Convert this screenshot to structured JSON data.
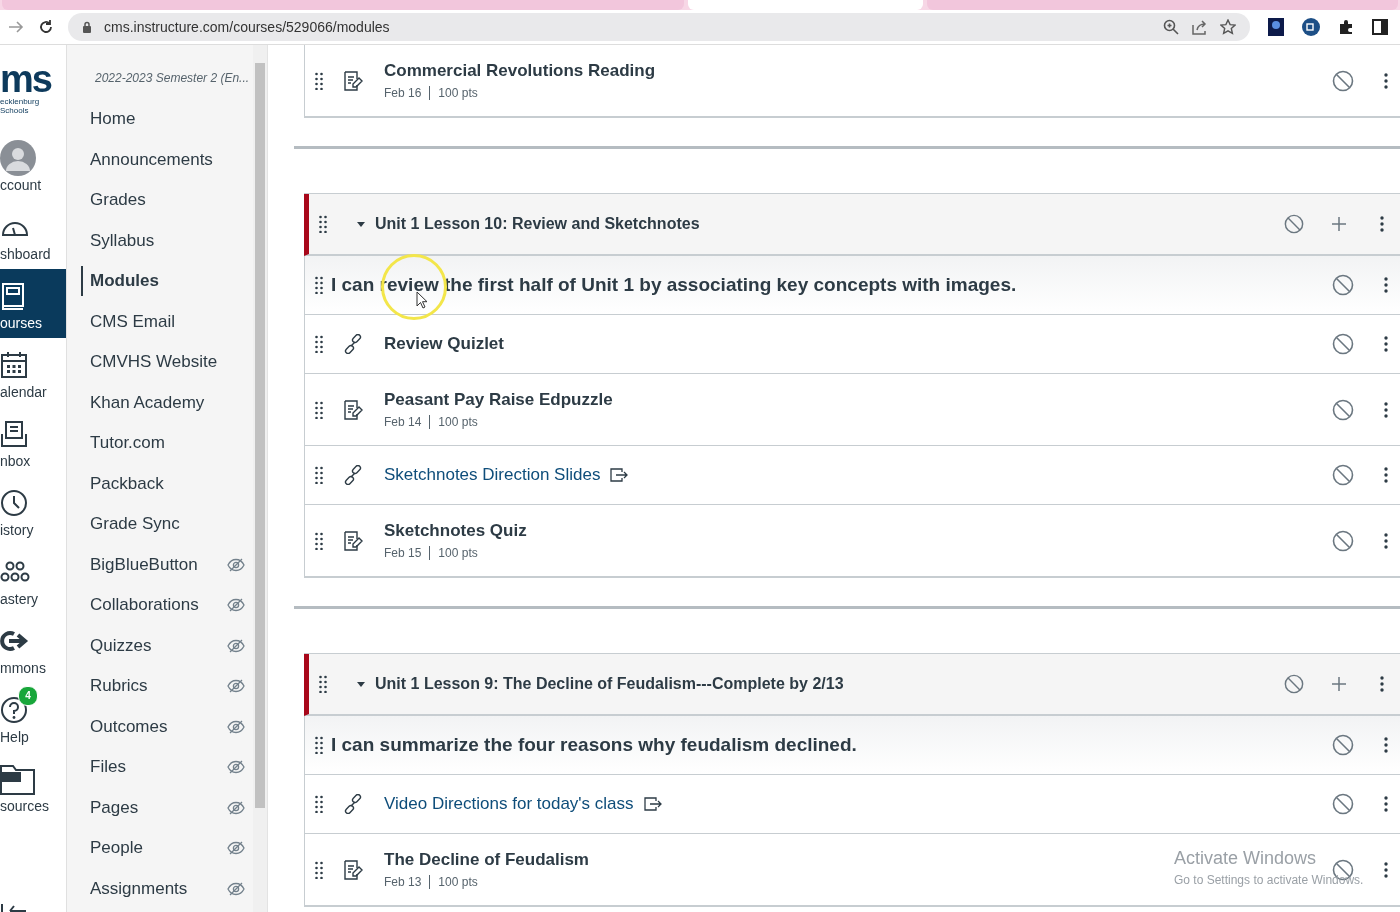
{
  "browser": {
    "tabs": [
      {
        "selected": false
      },
      {
        "selected": true
      },
      {
        "selected": false
      }
    ],
    "url": "cms.instructure.com/courses/529066/modules"
  },
  "global_nav": {
    "logo": {
      "text": "ms",
      "subtitle": "ecklenburg Schools"
    },
    "items": [
      {
        "label": "ccount",
        "kind": "avatar",
        "selected": false
      },
      {
        "label": "shboard",
        "kind": "dashboard",
        "selected": false
      },
      {
        "label": "ourses",
        "kind": "courses",
        "selected": true
      },
      {
        "label": "alendar",
        "kind": "calendar",
        "selected": false
      },
      {
        "label": "nbox",
        "kind": "inbox",
        "selected": false
      },
      {
        "label": "istory",
        "kind": "history",
        "selected": false
      },
      {
        "label": "astery",
        "kind": "mastery",
        "selected": false
      },
      {
        "label": "mmons",
        "kind": "commons",
        "selected": false
      },
      {
        "label": "Help",
        "kind": "help",
        "selected": false,
        "badge": "4"
      },
      {
        "label": "sources",
        "kind": "resources",
        "selected": false
      }
    ]
  },
  "course_nav": {
    "term": "2022-2023 Semester 2 (En...",
    "items": [
      {
        "label": "Home",
        "selected": false,
        "hidden": false
      },
      {
        "label": "Announcements",
        "selected": false,
        "hidden": false
      },
      {
        "label": "Grades",
        "selected": false,
        "hidden": false
      },
      {
        "label": "Syllabus",
        "selected": false,
        "hidden": false
      },
      {
        "label": "Modules",
        "selected": true,
        "hidden": false
      },
      {
        "label": "CMS Email",
        "selected": false,
        "hidden": false
      },
      {
        "label": "CMVHS Website",
        "selected": false,
        "hidden": false
      },
      {
        "label": "Khan Academy",
        "selected": false,
        "hidden": false
      },
      {
        "label": "Tutor.com",
        "selected": false,
        "hidden": false
      },
      {
        "label": "Packback",
        "selected": false,
        "hidden": false
      },
      {
        "label": "Grade Sync",
        "selected": false,
        "hidden": false
      },
      {
        "label": "BigBlueButton",
        "selected": false,
        "hidden": true
      },
      {
        "label": "Collaborations",
        "selected": false,
        "hidden": true
      },
      {
        "label": "Quizzes",
        "selected": false,
        "hidden": true
      },
      {
        "label": "Rubrics",
        "selected": false,
        "hidden": true
      },
      {
        "label": "Outcomes",
        "selected": false,
        "hidden": true
      },
      {
        "label": "Files",
        "selected": false,
        "hidden": true
      },
      {
        "label": "Pages",
        "selected": false,
        "hidden": true
      },
      {
        "label": "People",
        "selected": false,
        "hidden": true
      },
      {
        "label": "Assignments",
        "selected": false,
        "hidden": true
      }
    ]
  },
  "partial_module": {
    "items": [
      {
        "kind": "assignment",
        "title": "Commercial Revolutions Reading",
        "date": "Feb 16",
        "points": "100 pts"
      }
    ]
  },
  "modules": [
    {
      "title": "Unit 1 Lesson 10: Review and Sketchnotes",
      "expanded": true,
      "items": [
        {
          "kind": "subheader",
          "title": "I can review the first half of Unit 1 by associating key concepts with images."
        },
        {
          "kind": "link",
          "title": "Review Quizlet"
        },
        {
          "kind": "assignment",
          "title": "Peasant Pay Raise Edpuzzle",
          "date": "Feb 14",
          "points": "100 pts"
        },
        {
          "kind": "external_link",
          "title": "Sketchnotes Direction Slides"
        },
        {
          "kind": "assignment",
          "title": "Sketchnotes Quiz",
          "date": "Feb 15",
          "points": "100 pts"
        }
      ]
    },
    {
      "title": "Unit 1 Lesson 9: The Decline of Feudalism---Complete by 2/13",
      "expanded": true,
      "items": [
        {
          "kind": "subheader",
          "title": "I can summarize the four reasons why feudalism declined."
        },
        {
          "kind": "external_link",
          "title": "Video Directions for today's class"
        },
        {
          "kind": "assignment",
          "title": "The Decline of Feudalism",
          "date": "Feb 13",
          "points": "100 pts"
        }
      ]
    }
  ],
  "os_notice": {
    "title": "Activate Windows",
    "subtitle": "Go to Settings to activate Windows."
  }
}
